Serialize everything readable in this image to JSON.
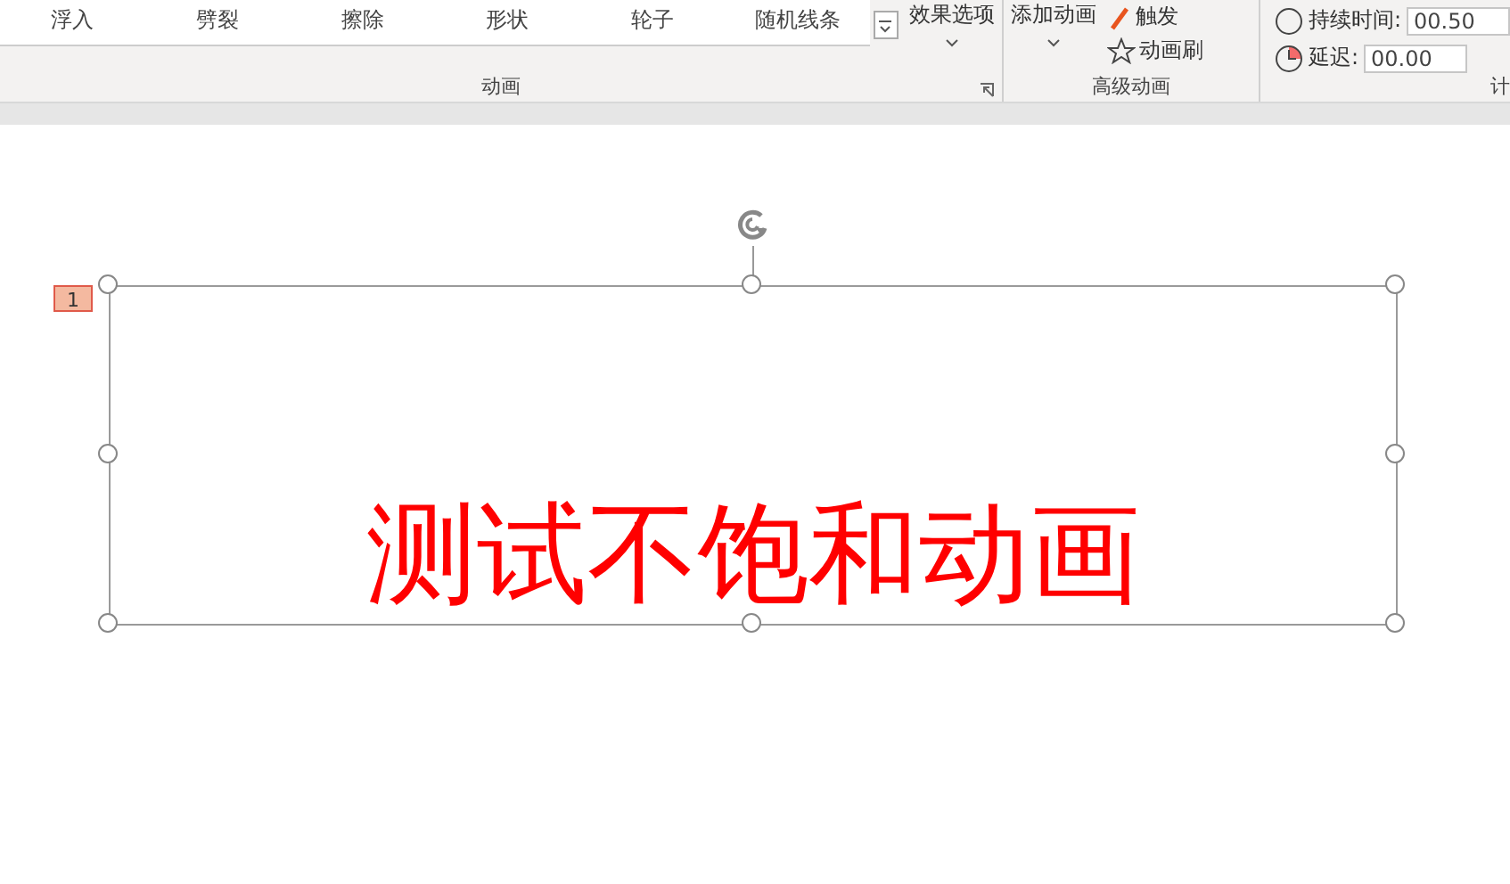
{
  "ribbon": {
    "animation_gallery": [
      {
        "label": "浮入"
      },
      {
        "label": "劈裂"
      },
      {
        "label": "擦除"
      },
      {
        "label": "形状"
      },
      {
        "label": "轮子"
      },
      {
        "label": "随机线条"
      }
    ],
    "effect_options": "效果选项",
    "animation_group_label": "动画",
    "add_animation": "添加动画",
    "trigger": "触发",
    "animation_painter": "动画刷",
    "advanced_group_label": "高级动画",
    "duration_label": "持续时间:",
    "duration_value": "00.50",
    "delay_label": "延迟:",
    "delay_value": "00.00",
    "timing_group_label": "计"
  },
  "slide": {
    "animation_tag": "1",
    "text": "测试不饱和动画"
  }
}
